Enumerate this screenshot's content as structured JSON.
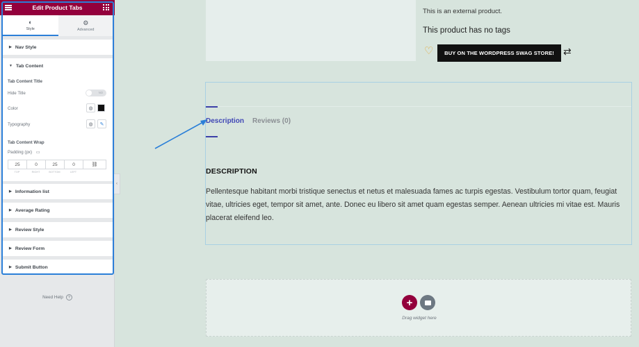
{
  "panel": {
    "title": "Edit Product Tabs",
    "tabs": [
      {
        "label": "Style",
        "icon": "contrast-icon"
      },
      {
        "label": "Advanced",
        "icon": "gear-icon"
      }
    ],
    "sections": {
      "nav_style": "Nav Style",
      "tab_content": "Tab Content",
      "information_list": "Information list",
      "average_rating": "Average Rating",
      "review_style": "Review Style",
      "review_form": "Review Form",
      "submit_button": "Submit Button"
    },
    "tab_content": {
      "title_heading": "Tab Content Title",
      "hide_title_label": "Hide Title",
      "hide_title_state": "NO",
      "color_label": "Color",
      "color_value": "#111111",
      "typography_label": "Typography",
      "wrap_heading": "Tab Content Wrap",
      "padding_label": "Padding (px)",
      "padding": {
        "top": "25",
        "right": "0",
        "bottom": "25",
        "left": "0"
      },
      "padding_labels": {
        "top": "TOP",
        "right": "RIGHT",
        "bottom": "BOTTOM",
        "left": "LEFT"
      }
    },
    "need_help": "Need Help"
  },
  "preview": {
    "external_text": "This is an external product.",
    "tags_text": "This product has no tags",
    "buy_button": "BUY ON THE WORDPRESS SWAG STORE!",
    "tabs": {
      "description": "Description",
      "reviews": "Reviews (0)"
    },
    "description_heading": "DESCRIPTION",
    "description_body": "Pellentesque habitant morbi tristique senectus et netus et malesuada fames ac turpis egestas. Vestibulum tortor quam, feugiat vitae, ultricies eget, tempor sit amet, ante. Donec eu libero sit amet quam egestas semper. Aenean ultricies mi vitae est. Mauris placerat eleifend leo.",
    "dropzone_text": "Drag widget here"
  },
  "colors": {
    "brand": "#93003c",
    "accent": "#2b7fd8",
    "active_tab": "#3f46b5",
    "background": "#d7e4dd"
  }
}
